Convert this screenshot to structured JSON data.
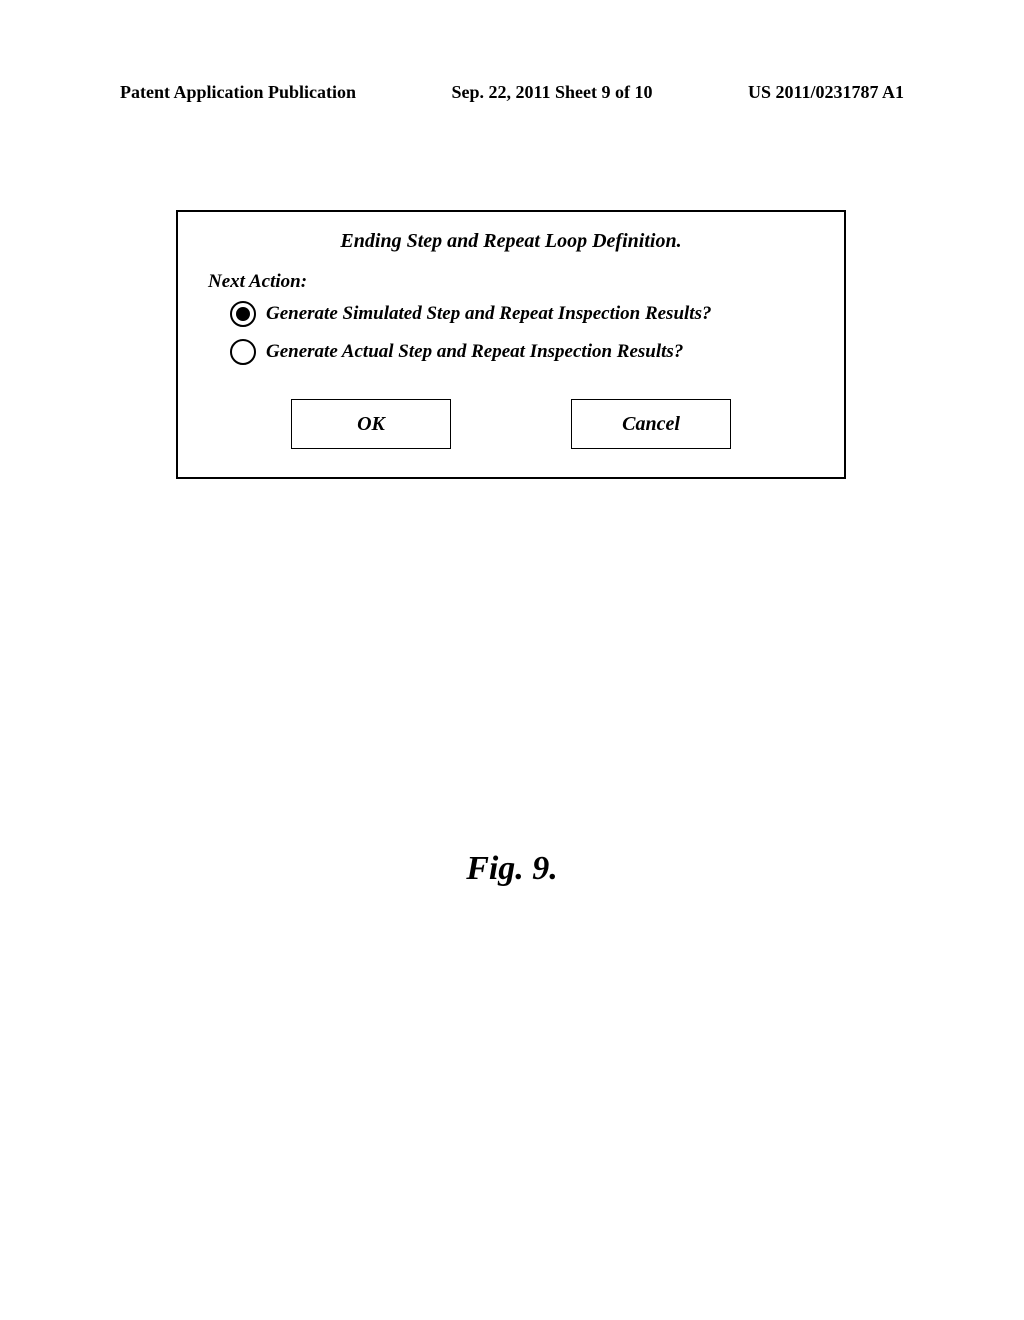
{
  "header": {
    "left": "Patent Application Publication",
    "center": "Sep. 22, 2011  Sheet 9 of 10",
    "right": "US 2011/0231787 A1"
  },
  "dialog": {
    "title": "Ending Step and Repeat Loop Definition.",
    "section_label": "Next Action:",
    "options": [
      {
        "label": "Generate Simulated Step and Repeat Inspection Results?",
        "selected": true
      },
      {
        "label": "Generate Actual Step and Repeat Inspection Results?",
        "selected": false
      }
    ],
    "buttons": {
      "ok": "OK",
      "cancel": "Cancel"
    }
  },
  "figure_label": "Fig. 9."
}
